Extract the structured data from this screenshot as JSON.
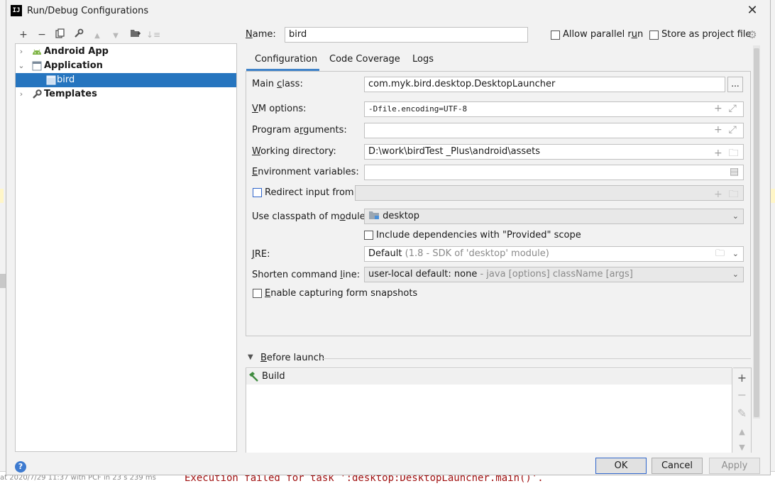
{
  "window": {
    "title": "Run/Debug Configurations",
    "app_icon_text": "IJ"
  },
  "background": {
    "status_text": "at 2020/7/29 11:37 with PCF in 23 s 239 ms",
    "exec_text": "Execution failed for task ':desktop:DesktopLauncher.main()'."
  },
  "toolbar": {
    "items": [
      {
        "name": "add-icon",
        "glyph": "+"
      },
      {
        "name": "remove-icon",
        "glyph": "−"
      },
      {
        "name": "copy-icon",
        "glyph": "⧉"
      },
      {
        "name": "wrench-icon",
        "glyph": "🔧"
      },
      {
        "name": "move-up-icon",
        "glyph": "▲"
      },
      {
        "name": "move-down-icon",
        "glyph": "▼"
      },
      {
        "name": "new-folder-icon",
        "glyph": "📁"
      },
      {
        "name": "sort-icon",
        "glyph": "↓"
      }
    ]
  },
  "tree": {
    "items": [
      {
        "label": "Android App",
        "icon": "android-icon",
        "expanded": false
      },
      {
        "label": "Application",
        "icon": "application-icon",
        "expanded": true
      },
      {
        "label": "bird",
        "icon": "application-config-icon",
        "selected": true
      },
      {
        "label": "Templates",
        "icon": "wrench-icon",
        "expanded": false
      }
    ]
  },
  "name_row": {
    "label_prefix": "N",
    "label_rest": "ame:",
    "value": "bird",
    "allow_parallel_prefix": "Allow parallel r",
    "allow_parallel_u": "u",
    "allow_parallel_rest": "n",
    "store_project": "Store as project file",
    "allow_parallel_checked": false,
    "store_project_checked": false
  },
  "tabs": [
    {
      "label": "Configuration",
      "active": true
    },
    {
      "label": "Code Coverage",
      "active": false
    },
    {
      "label": "Logs",
      "active": false
    }
  ],
  "form": {
    "main_class": {
      "label_a": "Main ",
      "label_u": "c",
      "label_b": "lass:",
      "value": "com.myk.bird.desktop.DesktopLauncher",
      "browse": "..."
    },
    "vm_options": {
      "label_u": "V",
      "label_b": "M options:",
      "value": "-Dfile.encoding=UTF-8"
    },
    "program_args": {
      "label_a": "Program a",
      "label_u": "r",
      "label_b": "guments:",
      "value": ""
    },
    "working_dir": {
      "label_u": "W",
      "label_b": "orking directory:",
      "value": "D:\\work\\birdTest _Plus\\android\\assets"
    },
    "env_vars": {
      "label_u": "E",
      "label_b": "nvironment variables:",
      "value": ""
    },
    "redirect_input": {
      "label": "Redirect input from:",
      "checked": false,
      "value": ""
    },
    "classpath": {
      "label_a": "Use classpath of m",
      "label_u": "o",
      "label_b": "dule:",
      "value": "desktop"
    },
    "include_deps": {
      "label": "Include dependencies with \"Provided\" scope",
      "checked": false
    },
    "jre": {
      "label_u": "J",
      "label_b": "RE:",
      "value": "Default",
      "hint": "(1.8 - SDK of 'desktop' module)"
    },
    "shorten_cmd": {
      "label_a": "Shorten command ",
      "label_u": "l",
      "label_b": "ine:",
      "value": "user-local default: none",
      "hint": "- java [options] className [args]"
    },
    "capture_snapshots": {
      "label_u": "E",
      "label_b": "nable capturing form snapshots",
      "checked": false
    }
  },
  "before_launch": {
    "title_u": "B",
    "title_rest": "efore launch",
    "items": [
      {
        "label": "Build",
        "icon": "hammer-icon"
      }
    ]
  },
  "buttons": {
    "help": "?",
    "ok": "OK",
    "cancel": "Cancel",
    "apply": "Apply"
  },
  "colors": {
    "selection": "#2675bf",
    "accent": "#4083c9",
    "android_green": "#7cb342"
  }
}
